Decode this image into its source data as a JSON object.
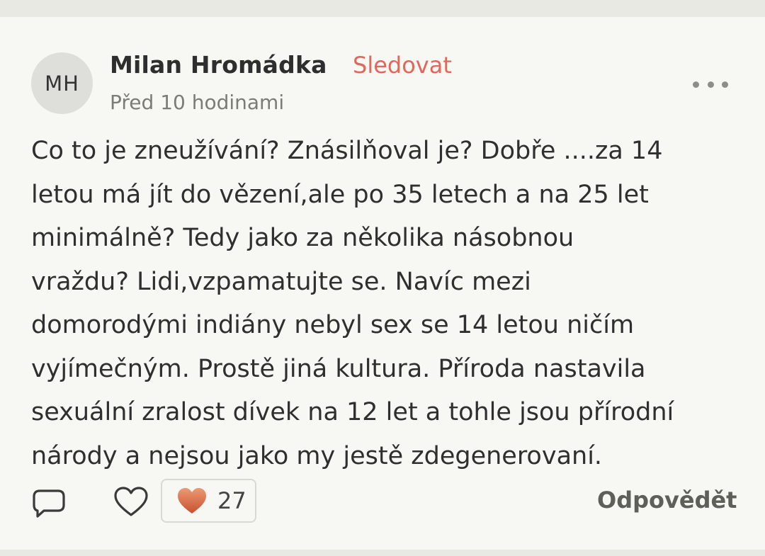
{
  "author": {
    "initials": "MH",
    "name": "Milan Hromádka",
    "follow_label": "Sledovat",
    "timestamp": "Před 10 hodinami"
  },
  "comment": {
    "lines": [
      "Co to je zneužívání? Znásilňoval je? Dobře ....za 14",
      "letou má jít do vězení,ale po 35 letech a na 25 let",
      "minimálně? Tedy jako za několika násobnou",
      "vraždu? Lidi,vzpamatujte se. Navíc mezi",
      "domorodými indiány nebyl sex se 14 letou ničím",
      "vyjímečným. Prostě jiná kultura. Příroda nastavila",
      "sexuální zralost dívek na 12 let a tohle jsou přírodní",
      "národy a nejsou jako my jestě zdegenerovaní."
    ]
  },
  "actions": {
    "reaction_count": "27",
    "reply_label": "Odpovědět"
  },
  "icons": {
    "more": "more-dots-icon",
    "reply": "speech-bubble-icon",
    "like": "heart-outline-icon",
    "reaction": "heart-filled-icon"
  },
  "colors": {
    "accent": "#e2675a",
    "background": "#f7f7f4",
    "text": "#2f2f2f",
    "muted": "#7c7c76"
  }
}
